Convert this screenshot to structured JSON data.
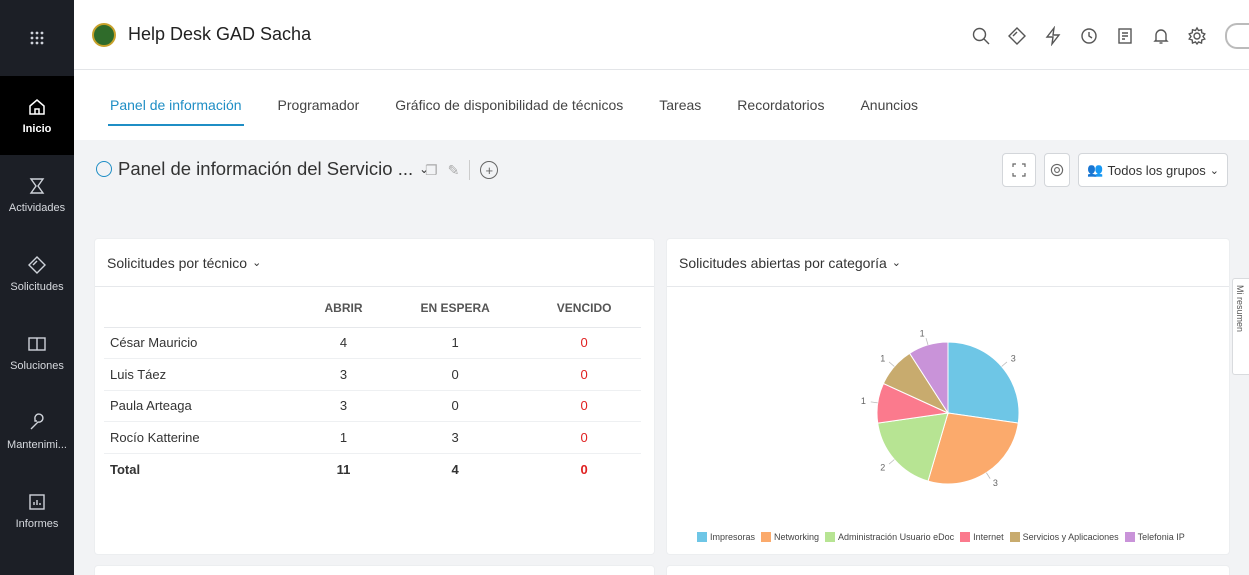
{
  "app": {
    "title": "Help Desk GAD Sacha"
  },
  "rail": {
    "items": [
      {
        "label": "Inicio",
        "icon": "home-icon"
      },
      {
        "label": "Actividades",
        "icon": "activities-icon"
      },
      {
        "label": "Solicitudes",
        "icon": "diamond-icon"
      },
      {
        "label": "Soluciones",
        "icon": "book-icon"
      },
      {
        "label": "Mantenimi...",
        "icon": "wrench-icon"
      },
      {
        "label": "Informes",
        "icon": "report-icon"
      }
    ]
  },
  "tabs": [
    "Panel de información",
    "Programador",
    "Gráfico de disponibilidad de técnicos",
    "Tareas",
    "Recordatorios",
    "Anuncios"
  ],
  "dashboard": {
    "title": "Panel de información del Servicio ...",
    "groups_label": "Todos los grupos"
  },
  "widget_technicians": {
    "title": "Solicitudes por técnico",
    "columns": [
      "ABRIR",
      "EN ESPERA",
      "VENCIDO"
    ],
    "rows": [
      {
        "name": "César Mauricio",
        "abrir": "4",
        "espera": "1",
        "vencido": "0"
      },
      {
        "name": "Luis Táez",
        "abrir": "3",
        "espera": "0",
        "vencido": "0"
      },
      {
        "name": "Paula Arteaga",
        "abrir": "3",
        "espera": "0",
        "vencido": "0"
      },
      {
        "name": "Rocío Katterine",
        "abrir": "1",
        "espera": "3",
        "vencido": "0"
      }
    ],
    "total": {
      "name": "Total",
      "abrir": "11",
      "espera": "4",
      "vencido": "0"
    }
  },
  "widget_categories": {
    "title": "Solicitudes abiertas por categoría"
  },
  "side_tab": "Mi resumen",
  "chart_data": {
    "type": "pie",
    "categories": [
      "Impresoras",
      "Networking",
      "Administración Usuario eDoc",
      "Internet",
      "Servicios y Aplicaciones",
      "Telefonia IP"
    ],
    "values": [
      3,
      3,
      2,
      1,
      1,
      1
    ],
    "colors": [
      "#6ec6e6",
      "#fbaa6c",
      "#b7e493",
      "#fb7a8d",
      "#c8ab6e",
      "#c993d9"
    ],
    "legend": "bottom"
  }
}
